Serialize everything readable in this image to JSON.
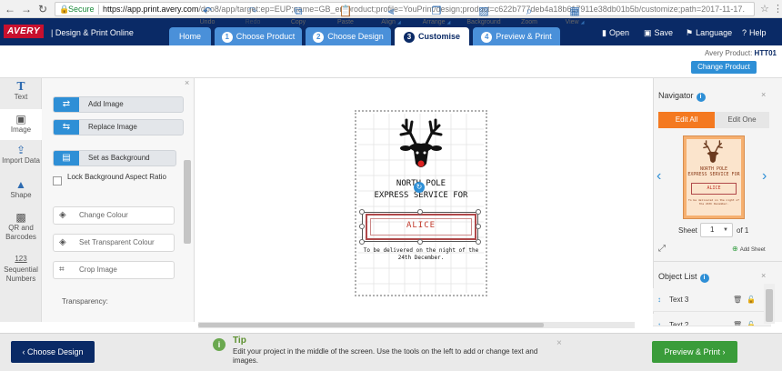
{
  "browser": {
    "secure_label": "Secure",
    "url_host": "https://app.print.avery.com",
    "url_rest": "/dpo8/app/target:ep=EUP;name=GB_en/product;profile=YouPrint/design;product=c622b777deb4a18b617911e38db01b5b/customize;path=2017-11-17..."
  },
  "header": {
    "logo": "AVERY",
    "app_title": "Design & Print Online",
    "tabs": [
      {
        "label": "Home",
        "num": ""
      },
      {
        "label": "Choose Product",
        "num": "1"
      },
      {
        "label": "Choose Design",
        "num": "2"
      },
      {
        "label": "Customise",
        "num": "3"
      },
      {
        "label": "Preview & Print",
        "num": "4"
      }
    ],
    "open": "Open",
    "save": "Save",
    "language": "Language",
    "help": "Help"
  },
  "toolbar": {
    "undo": "Undo",
    "redo": "Redo",
    "copy": "Copy",
    "paste": "Paste",
    "align": "Align",
    "arrange": "Arrange",
    "background": "Background",
    "zoom": "Zoom",
    "view": "View",
    "product_label": "Avery Product:",
    "product_code": "HTT01",
    "change_product": "Change Product"
  },
  "rail": {
    "items": [
      {
        "label": "Text",
        "icon": "text-icon"
      },
      {
        "label": "Image",
        "icon": "image-icon"
      },
      {
        "label": "Import Data",
        "icon": "import-data-icon"
      },
      {
        "label": "Shape",
        "icon": "shape-icon"
      },
      {
        "label": "QR and Barcodes",
        "icon": "qr-icon"
      },
      {
        "label": "Sequential Numbers",
        "icon": "numbers-icon"
      }
    ]
  },
  "panel": {
    "add_image": "Add Image",
    "replace_image": "Replace Image",
    "set_background": "Set as Background",
    "lock_bg": "Lock Background Aspect Ratio",
    "change_colour": "Change Colour",
    "set_transparent": "Set Transparent Colour",
    "crop_image": "Crop Image",
    "transparency": "Transparency:"
  },
  "design": {
    "line1": "NORTH POLE",
    "line2": "EXPRESS SERVICE FOR",
    "name": "ALICE",
    "deliver": "To be delivered on the night of the 24th December."
  },
  "navigator": {
    "title": "Navigator",
    "edit_all": "Edit All",
    "edit_one": "Edit One",
    "sheet_label": "Sheet",
    "sheet_value": "1",
    "of_label": "of 1",
    "add_sheet": "Add Sheet"
  },
  "object_list": {
    "title": "Object List",
    "items": [
      {
        "name": "Text 3"
      },
      {
        "name": "Text 2"
      }
    ]
  },
  "footer": {
    "choose_design": "Choose Design",
    "tip_title": "Tip",
    "tip_text": "Edit your project in the middle of the screen. Use the tools on the left to add or change text and images.",
    "preview_print": "Preview & Print"
  },
  "colors": {
    "brand_navy": "#0a2a66",
    "accent_blue": "#2e8fd6",
    "edit_all_orange": "#f47920",
    "preview_green": "#3a9c3a",
    "alice_red": "#c0392b"
  }
}
